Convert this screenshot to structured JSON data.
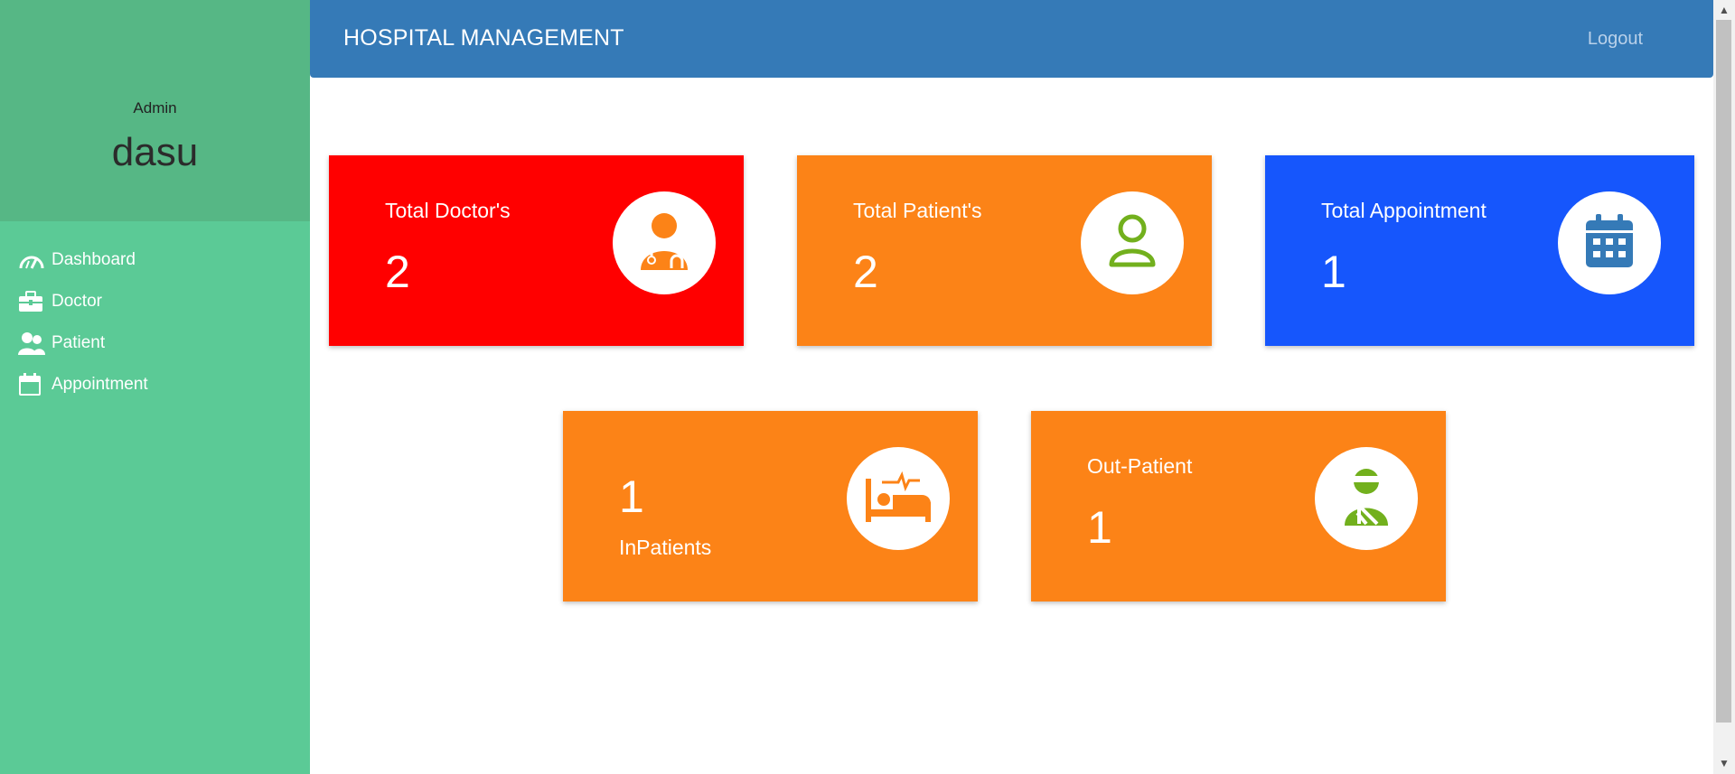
{
  "sidebar": {
    "role": "Admin",
    "username": "dasu",
    "items": [
      {
        "label": "Dashboard",
        "icon": "gauge-icon"
      },
      {
        "label": "Doctor",
        "icon": "briefcase-icon"
      },
      {
        "label": "Patient",
        "icon": "users-icon"
      },
      {
        "label": "Appointment",
        "icon": "calendar-icon"
      }
    ]
  },
  "header": {
    "title": "HOSPITAL MANAGEMENT",
    "logout": "Logout"
  },
  "cards": {
    "doctors": {
      "label": "Total Doctor's",
      "value": "2",
      "icon": "doctor-icon",
      "color": "#ff0000"
    },
    "patients": {
      "label": "Total Patient's",
      "value": "2",
      "icon": "user-icon",
      "color": "#fc8317"
    },
    "appointments": {
      "label": "Total Appointment",
      "value": "1",
      "icon": "calendar-icon",
      "color": "#1656fc"
    },
    "inpatients": {
      "label": "InPatients",
      "value": "1",
      "icon": "bed-icon",
      "color": "#fc8317"
    },
    "outpatients": {
      "label": "Out-Patient",
      "value": "1",
      "icon": "injured-icon",
      "color": "#fc8317"
    }
  },
  "colors": {
    "sidebar": "#5bca96",
    "sidebar_header": "#56b785",
    "topbar": "#357ab7",
    "icon_orange": "#fc8317",
    "icon_green": "#72b01d",
    "icon_blue": "#357ab7"
  }
}
